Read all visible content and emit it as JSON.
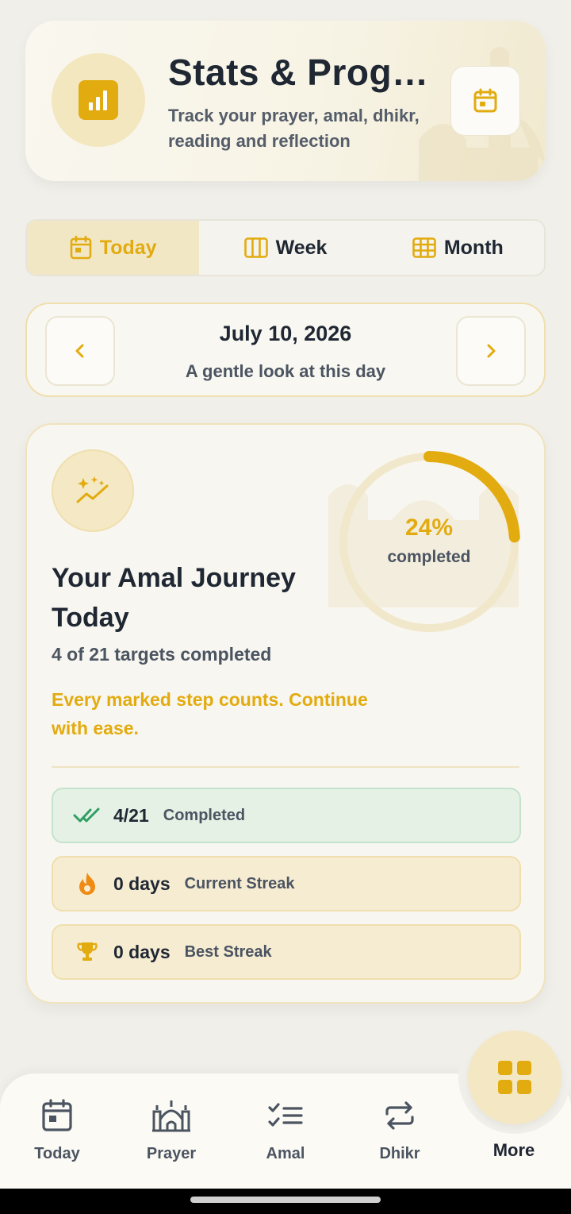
{
  "header": {
    "title": "Stats & Progress",
    "subtitle": "Track your prayer, amal, dhikr, reading and reflection",
    "icon": "bar-chart-icon",
    "calendar_button_icon": "calendar-icon"
  },
  "tabs": [
    {
      "label": "Today",
      "icon": "calendar-day-icon",
      "active": true
    },
    {
      "label": "Week",
      "icon": "week-columns-icon",
      "active": false
    },
    {
      "label": "Month",
      "icon": "month-grid-icon",
      "active": false
    }
  ],
  "date_nav": {
    "date": "July 10, 2026",
    "subtitle": "A gentle look at this day",
    "prev_icon": "chevron-left-icon",
    "next_icon": "chevron-right-icon"
  },
  "journey": {
    "title": "Your Amal Journey Today",
    "count_text": "4 of 21 targets completed",
    "quote": "Every marked step counts. Continue with ease.",
    "progress_percent": 24,
    "progress_text": "24%",
    "progress_label": "completed",
    "stats": [
      {
        "value": "4/21",
        "label": "Completed",
        "icon": "double-check-icon"
      },
      {
        "value": "0 days",
        "label": "Current Streak",
        "icon": "flame-icon"
      },
      {
        "value": "0 days",
        "label": "Best Streak",
        "icon": "trophy-icon"
      }
    ]
  },
  "bottom_nav": [
    {
      "label": "Today",
      "icon": "calendar-icon"
    },
    {
      "label": "Prayer",
      "icon": "mosque-icon"
    },
    {
      "label": "Amal",
      "icon": "checklist-icon"
    },
    {
      "label": "Dhikr",
      "icon": "repeat-icon"
    },
    {
      "label": "More",
      "icon": "grid-icon"
    }
  ],
  "colors": {
    "accent": "#e2ab0f",
    "background": "#f1efe9",
    "text_primary": "#1f2733",
    "text_secondary": "#4b5461",
    "success": "#2f9e63"
  }
}
